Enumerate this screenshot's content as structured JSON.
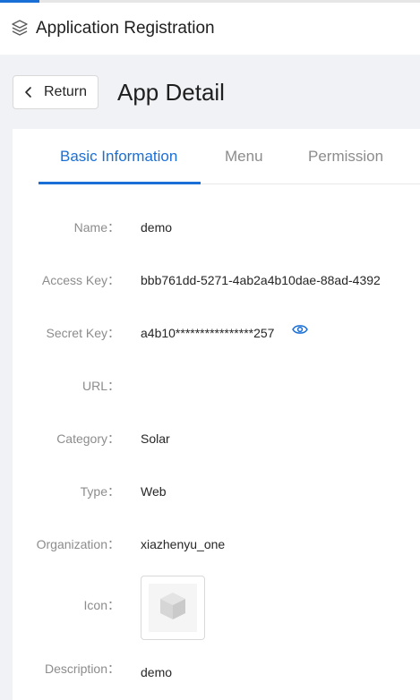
{
  "header": {
    "title": "Application Registration",
    "logo_icon": "layers-icon"
  },
  "page": {
    "return_label": "Return",
    "title": "App Detail"
  },
  "tabs": [
    {
      "label": "Basic Information",
      "active": true
    },
    {
      "label": "Menu",
      "active": false
    },
    {
      "label": "Permission",
      "active": false
    }
  ],
  "fields": {
    "name": {
      "label": "Name",
      "value": "demo"
    },
    "access_key": {
      "label": "Access Key",
      "value": "bbb761dd-5271-4ab2a4b10dae-88ad-4392"
    },
    "secret_key": {
      "label": "Secret Key",
      "value": "a4b10****************257"
    },
    "url": {
      "label": "URL",
      "value": ""
    },
    "category": {
      "label": "Category",
      "value": "Solar"
    },
    "type": {
      "label": "Type",
      "value": "Web"
    },
    "organization": {
      "label": "Organization",
      "value": "xiazhenyu_one"
    },
    "icon": {
      "label": "Icon"
    },
    "description": {
      "label": "Description",
      "value": "demo"
    }
  },
  "colors": {
    "accent": "#1a6fd6",
    "label": "#8c8c8c",
    "text": "#262626"
  }
}
